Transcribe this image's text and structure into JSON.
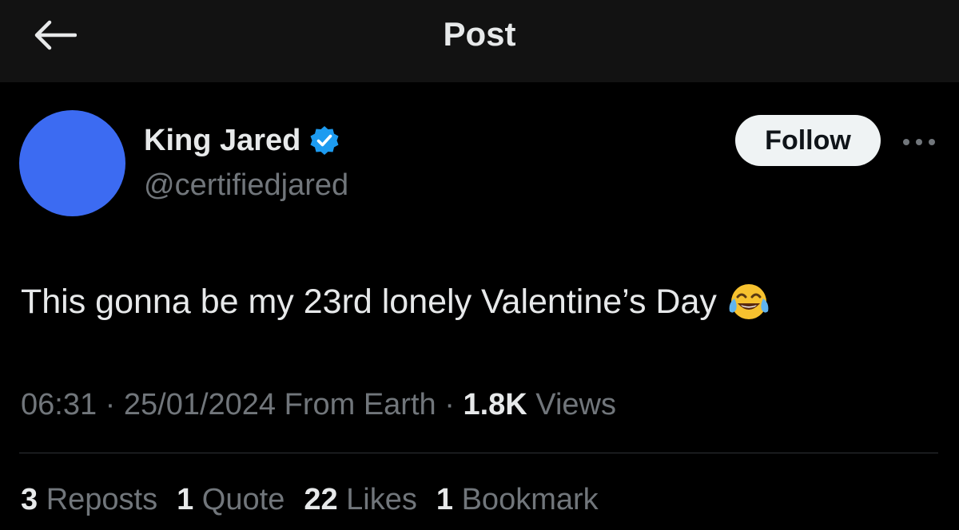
{
  "header": {
    "title": "Post",
    "back_icon": "arrow-left-icon"
  },
  "author": {
    "name": "King Jared",
    "handle": "@certifiedjared",
    "verified": true,
    "verified_icon": "verified-badge-icon",
    "avatar_color": "#3c6bf2"
  },
  "actions": {
    "follow_label": "Follow",
    "more_icon": "more-horizontal-icon"
  },
  "post": {
    "text": "This gonna be my 23rd lonely Valentine’s Day",
    "emoji": "face-with-tears-of-joy-icon"
  },
  "meta": {
    "time": "06:31",
    "sep1": " · ",
    "date": "25/01/2024",
    "source": " From Earth",
    "sep2": " · ",
    "views_count": "1.8K",
    "views_label": " Views"
  },
  "stats": [
    {
      "count": "3",
      "label": " Reposts"
    },
    {
      "count": "1",
      "label": " Quote"
    },
    {
      "count": "22",
      "label": " Likes"
    },
    {
      "count": "1",
      "label": " Bookmark"
    }
  ],
  "colors": {
    "background": "#000000",
    "topbar": "#121212",
    "primary_text": "#e7e9ea",
    "secondary_text": "#71767b",
    "verified_blue": "#1d9bf0",
    "follow_bg": "#eff3f4"
  }
}
